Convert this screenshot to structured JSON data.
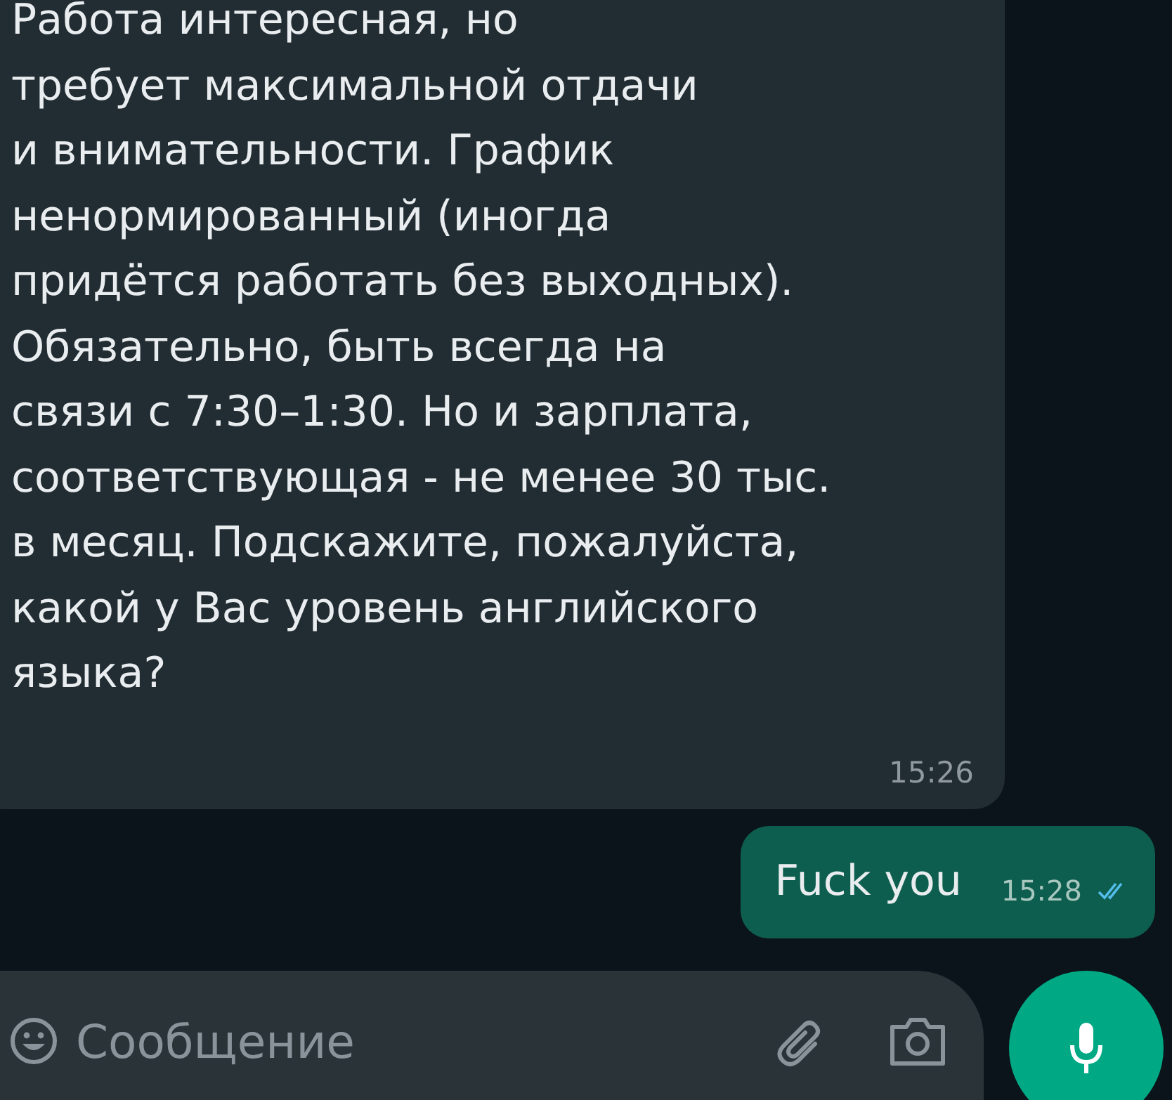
{
  "messages": [
    {
      "outgoing": false,
      "lines": [
        "Работа интересная, но",
        "требует максимальной отдачи",
        "и внимательности. График",
        "ненормированный (иногда",
        "придётся работать без выходных).",
        "Обязательно, быть всегда на",
        "связи с 7:30–1:30. Но и зарплата,",
        "соответствующая - не менее 30 тыс.",
        "в месяц. Подскажите, пожалуйста,",
        "какой у Вас уровень английского",
        "языка?"
      ],
      "time": "15:26"
    },
    {
      "outgoing": true,
      "lines": [
        "Fuck you"
      ],
      "time": "15:28",
      "read": true
    }
  ],
  "composer": {
    "placeholder": "Сообщение"
  }
}
